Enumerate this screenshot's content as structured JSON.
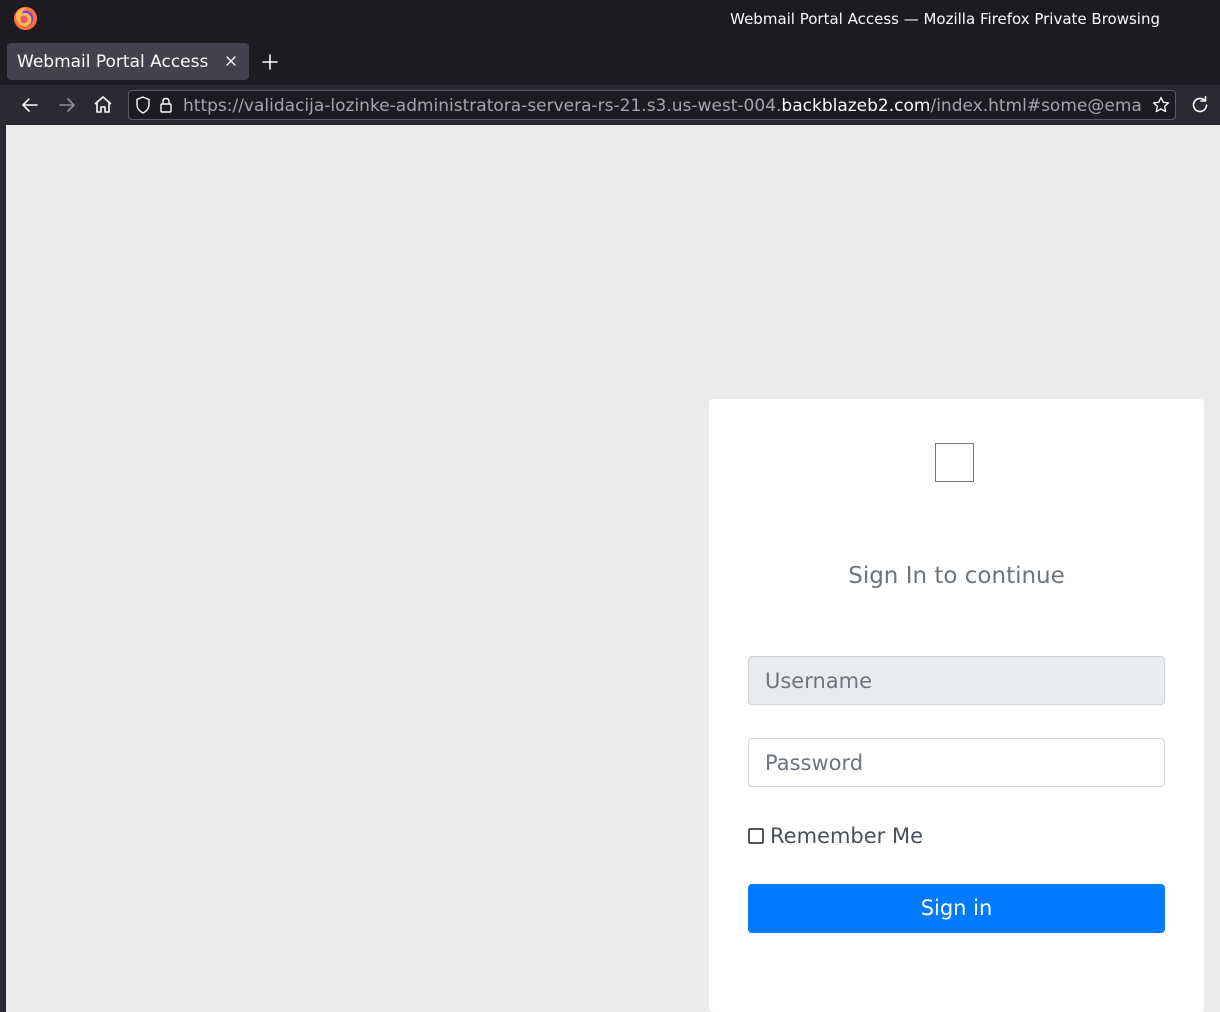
{
  "window": {
    "title": "Webmail Portal Access — Mozilla Firefox Private Browsing"
  },
  "tabs": [
    {
      "label": "Webmail Portal Access",
      "active": true
    }
  ],
  "navbar": {
    "url_prefix": "https://validacija-lozinke-administratora-servera-rs-21.s3.us-west-004.",
    "url_host": "backblazeb2.com",
    "url_suffix": "/index.html#some@email"
  },
  "login": {
    "heading": "Sign In to continue",
    "username_placeholder": "Username",
    "password_placeholder": "Password",
    "remember_label": "Remember Me",
    "remember_checked": false,
    "submit_label": "Sign in"
  },
  "colors": {
    "primary_button": "#007bff",
    "page_background": "#ebebeb",
    "browser_chrome": "#1c1b22"
  },
  "icons": {
    "browser_logo": "firefox-icon",
    "back": "arrow-left-icon",
    "forward": "arrow-right-icon",
    "home": "home-icon",
    "tracking": "shield-icon",
    "secure": "lock-icon",
    "bookmark": "star-icon",
    "reload": "reload-icon",
    "close_tab": "close-icon",
    "new_tab": "plus-icon"
  }
}
